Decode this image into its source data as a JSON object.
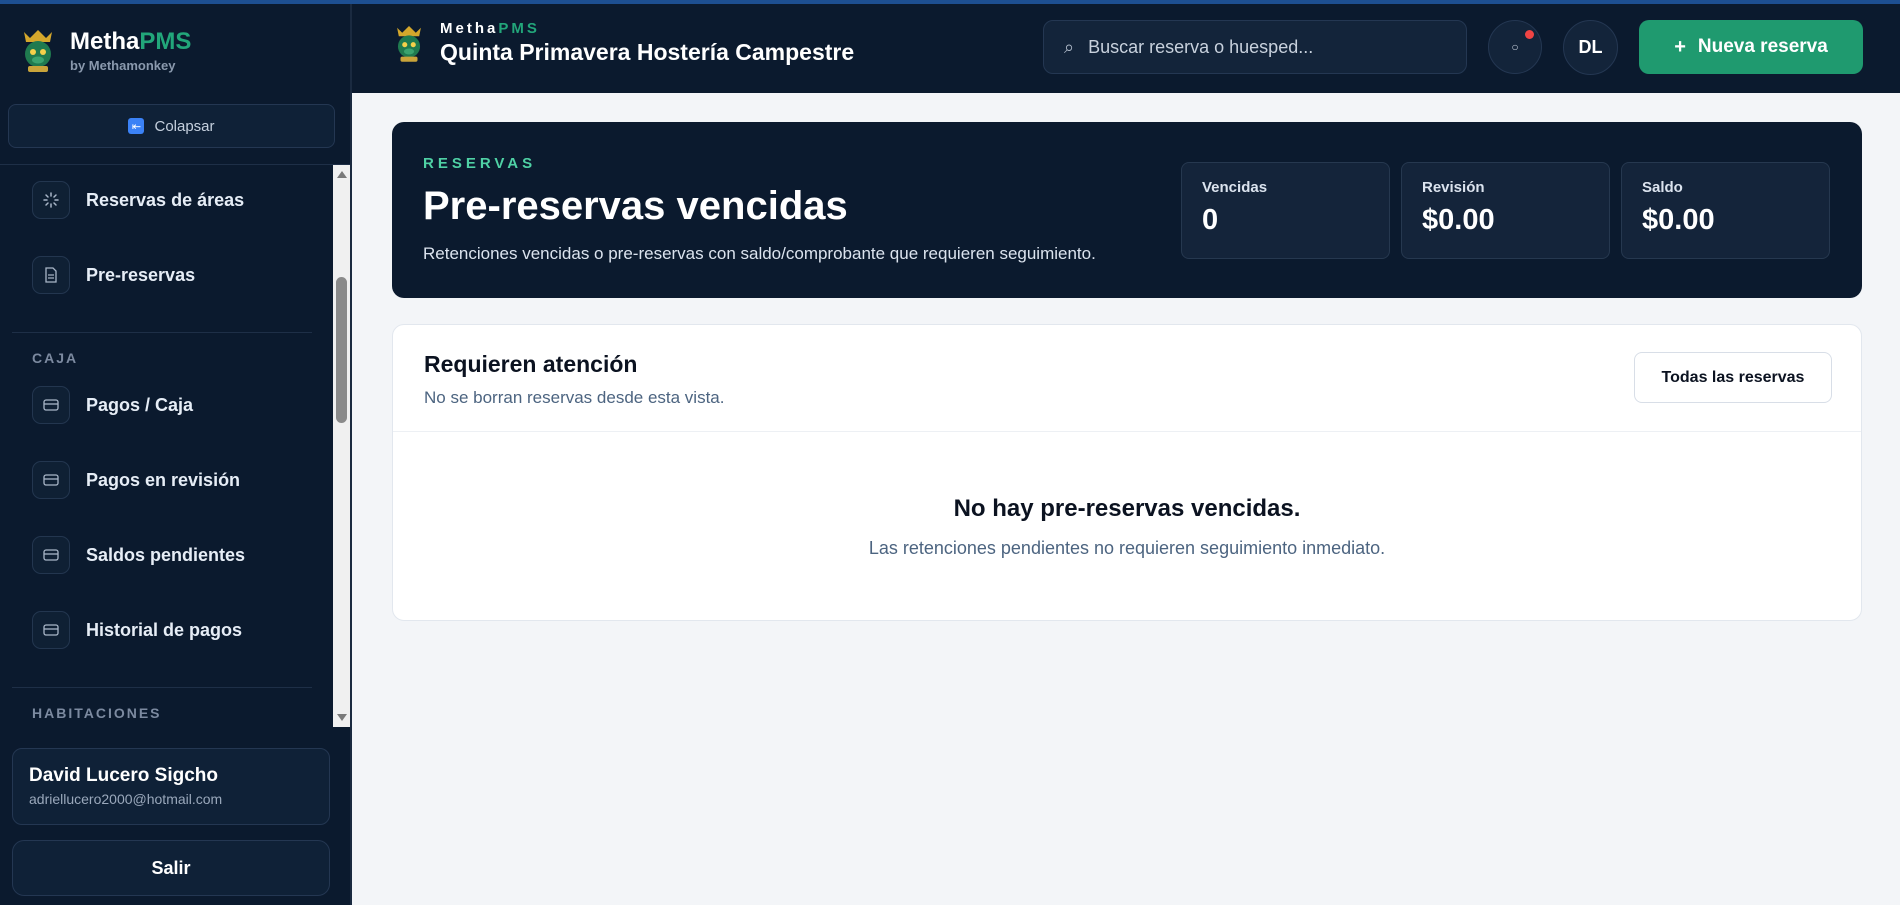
{
  "brand": {
    "name_main": "Metha",
    "name_accent": "PMS",
    "subtitle": "by Methamonkey"
  },
  "sidebar": {
    "collapse_label": "Colapsar",
    "items": [
      {
        "label": "Reservas de áreas",
        "icon": "spinner-icon"
      },
      {
        "label": "Pre-reservas",
        "icon": "document-icon"
      },
      {
        "label": "Pagos / Caja",
        "icon": "card-icon"
      },
      {
        "label": "Pagos en revisión",
        "icon": "card-icon"
      },
      {
        "label": "Saldos pendientes",
        "icon": "card-icon"
      },
      {
        "label": "Historial de pagos",
        "icon": "card-icon"
      }
    ],
    "section_caja": "CAJA",
    "section_habitaciones": "HABITACIONES"
  },
  "user": {
    "name": "David Lucero Sigcho",
    "email": "adriellucero2000@hotmail.com",
    "logout_label": "Salir"
  },
  "header": {
    "app_main": "Metha",
    "app_accent": "PMS",
    "hotel_name": "Quinta Primavera Hostería Campestre",
    "search_placeholder": "Buscar reserva o huesped...",
    "avatar_initials": "DL",
    "new_reservation_label": "Nueva reserva"
  },
  "hero": {
    "eyebrow": "RESERVAS",
    "title": "Pre-reservas vencidas",
    "description": "Retenciones vencidas o pre-reservas con saldo/comprobante que requieren seguimiento.",
    "stats": [
      {
        "label": "Vencidas",
        "value": "0"
      },
      {
        "label": "Revisión",
        "value": "$0.00"
      },
      {
        "label": "Saldo",
        "value": "$0.00"
      }
    ]
  },
  "attention": {
    "title": "Requieren atención",
    "subtitle": "No se borran reservas desde esta vista.",
    "all_button_label": "Todas las reservas",
    "empty_title": "No hay pre-reservas vencidas.",
    "empty_subtitle": "Las retenciones pendientes no requieren seguimiento inmediato."
  },
  "colors": {
    "navy": "#0b1a2e",
    "accent_green": "#1f9a6f",
    "eyebrow_green": "#4fd1a5",
    "notification_red": "#ef4444"
  }
}
